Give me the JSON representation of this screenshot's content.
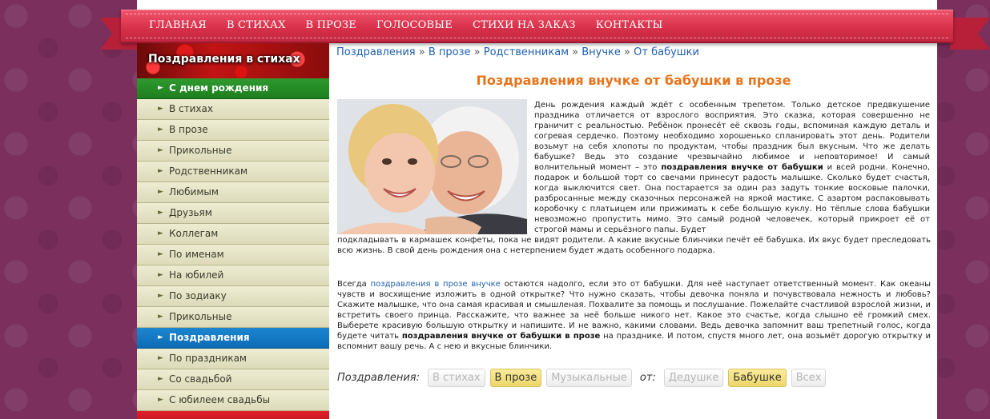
{
  "nav": {
    "items": [
      "ГЛАВНАЯ",
      "В СТИХАХ",
      "В ПРОЗЕ",
      "ГОЛОСОВЫЕ",
      "СТИХИ НА ЗАКАЗ",
      "КОНТАКТЫ"
    ]
  },
  "sidebar": {
    "header": "Поздравления в стихах",
    "items": [
      {
        "label": "С днем рождения",
        "style": "green"
      },
      {
        "label": "В стихах",
        "style": "normal"
      },
      {
        "label": "В прозе",
        "style": "normal"
      },
      {
        "label": "Прикольные",
        "style": "normal"
      },
      {
        "label": "Родственникам",
        "style": "normal"
      },
      {
        "label": "Любимым",
        "style": "normal"
      },
      {
        "label": "Друзьям",
        "style": "normal"
      },
      {
        "label": "Коллегам",
        "style": "normal"
      },
      {
        "label": "По именам",
        "style": "normal"
      },
      {
        "label": "На юбилей",
        "style": "normal"
      },
      {
        "label": "По зодиаку",
        "style": "normal"
      },
      {
        "label": "Прикольные",
        "style": "normal"
      },
      {
        "label": "Поздравления",
        "style": "blue"
      },
      {
        "label": "По праздникам",
        "style": "normal"
      },
      {
        "label": "Со свадьбой",
        "style": "normal"
      },
      {
        "label": "С юбилеем свадьбы",
        "style": "normal"
      }
    ]
  },
  "breadcrumb": {
    "items": [
      "Поздравления",
      "В прозе",
      "Родственникам",
      "Внучке",
      "От бабушки"
    ],
    "separator": "»"
  },
  "title": "Поздравления внучке от бабушки в прозе",
  "paragraph1": {
    "part_a": "День рождения каждый ждёт с особенным трепетом. Только детское предвкушение праздника отличается от взрослого восприятия. Это сказка, которая совершенно не граничит с реальностью. Ребёнок пронесёт её сквозь годы, вспоминая каждую деталь и согревая сердечко. Поэтому необходимо хорошенько спланировать этот день. Родители возьмут на себя хлопоты по продуктам, чтобы праздник был вкусным. Что же делать бабушке? Ведь это создание чрезвычайно любимое и неповторимое! И самый волнительный момент – это",
    "bold": "поздравления внучке от бабушки",
    "part_b": "и всей родни. Конечно, подарок и большой торт со свечами принесут радость малышке. Сколько будет счастья, когда выключится свет. Она постарается за один раз задуть тонкие восковые палочки, разбросанные между сказочных персонажей на яркой мастике. С азартом распаковывать коробочку с платьицем или прижимать к себе большую куклу. Но тёплые слова бабушки невозможно пропустить мимо. Это самый родной человечек, который прикроет её от строгой мамы и серьёзного папы. Будет",
    "part_c": "подкладывать в кармашек конфеты, пока не видят родители. А какие вкусные блинчики печёт её бабушка. Их вкус будет преследовать всю жизнь. В свой день рождения она с нетерпением будет ждать особенного подарка."
  },
  "paragraph2": {
    "lead": "Всегда",
    "link": "поздравления в прозе внучке",
    "part_a": "остаются надолго, если это от бабушки. Для неё наступает ответственный момент. Как океаны чувств и восхищение изложить в одной открытке? Что нужно сказать, чтобы девочка поняла и почувствовала нежность и любовь? Скажите малышке, что она самая красивая и смышленая. Похвалите за помощь и послушание. Пожелайте счастливой взрослой жизни, и встретить своего принца. Расскажите, что важнее за неё больше никого нет. Какое это счастье, когда слышно её громкий смех. Выберете красивую большую открытку и напишите. И не важно, какими словами. Ведь девочка запомнит ваш трепетный голос, когда будете читать",
    "bold": "поздравления внучке от бабушки в прозе",
    "part_b": "на празднике. И потом, спустя много лет, она возьмёт дорогую открытку и вспомнит вашу речь. А с нею и вкусные блинчики."
  },
  "filters": {
    "label1": "Поздравления:",
    "group1": [
      {
        "label": "В стихах",
        "active": false
      },
      {
        "label": "В прозе",
        "active": true
      },
      {
        "label": "Музыкальные",
        "active": false
      }
    ],
    "label2": "от:",
    "group2": [
      {
        "label": "Дедушке",
        "active": false
      },
      {
        "label": "Бабушке",
        "active": true
      },
      {
        "label": "Всех",
        "active": false
      }
    ]
  }
}
